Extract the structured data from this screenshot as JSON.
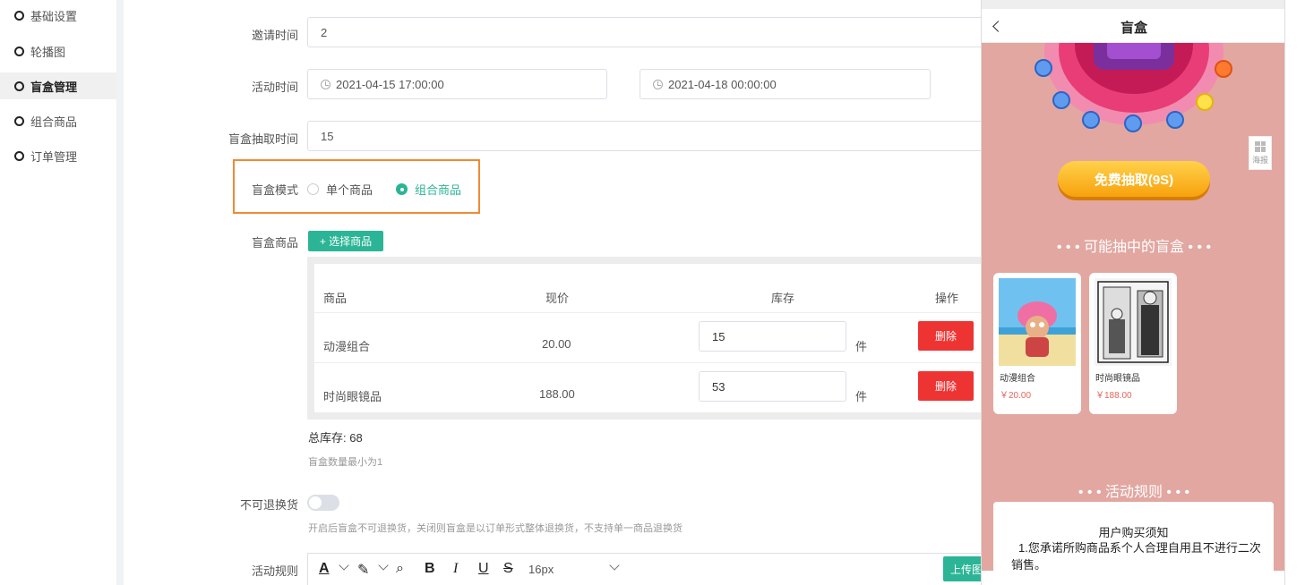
{
  "sidebar": {
    "items": [
      {
        "label": "基础设置",
        "active": false
      },
      {
        "label": "轮播图",
        "active": false
      },
      {
        "label": "盲盒管理",
        "active": true
      },
      {
        "label": "组合商品",
        "active": false
      },
      {
        "label": "订单管理",
        "active": false
      }
    ]
  },
  "form": {
    "invite_time": {
      "label": "邀请时间",
      "value": "2"
    },
    "activity_time": {
      "label": "活动时间",
      "start": "2021-04-15 17:00:00",
      "end": "2021-04-18 00:00:00"
    },
    "draw_time": {
      "label": "盲盒抽取时间",
      "value": "15"
    },
    "mode": {
      "label": "盲盒模式",
      "options": [
        "单个商品",
        "组合商品"
      ],
      "selected": "组合商品"
    },
    "goods": {
      "label": "盲盒商品",
      "select_button": "+ 选择商品",
      "columns": [
        "商品",
        "现价",
        "库存",
        "操作"
      ],
      "rows": [
        {
          "name": "动漫组合",
          "price": "20.00",
          "stock": "15",
          "unit": "件",
          "action": "删除"
        },
        {
          "name": "时尚眼镜品",
          "price": "188.00",
          "stock": "53",
          "unit": "件",
          "action": "删除"
        }
      ],
      "total_stock_label": "总库存:",
      "total_stock": "68",
      "hint": "盲盒数量最小为1"
    },
    "no_return": {
      "label": "不可退换货",
      "enabled": false,
      "hint": "开启后盲盒不可退换货，关闭则盲盒是以订单形式整体退换货，不支持单一商品退换货"
    },
    "rules": {
      "label": "活动规则",
      "font_size": "16px",
      "upload_button": "上传图"
    }
  },
  "phone": {
    "title": "盲盒",
    "poster_label": "海报",
    "draw_button": "免费抽取(9S)",
    "possible_title": "• • • 可能抽中的盲盒 • • •",
    "cards": [
      {
        "name": "动漫组合",
        "price": "￥20.00"
      },
      {
        "name": "时尚眼镜品",
        "price": "￥188.00"
      }
    ],
    "rules_title": "• • • 活动规则 • • •",
    "rules_box_title": "用户购买须知",
    "rules_box_text": "1.您承诺所购商品系个人合理自用且不进行二次销售。"
  },
  "colors": {
    "accent": "#2bb596",
    "danger": "#ee3333",
    "highlight": "#f08a33",
    "phone_bg": "#e2a7a1"
  }
}
